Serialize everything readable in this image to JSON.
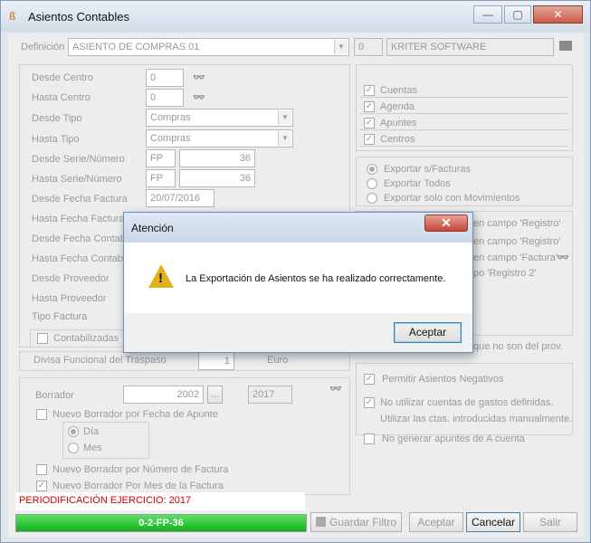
{
  "window": {
    "title": "Asientos Contables",
    "minimize": "—",
    "maximize": "▢",
    "close": "✕"
  },
  "definicion": {
    "label": "Definición",
    "value": "ASIENTO DE COMPRAS 01",
    "code": "0",
    "company": "KRITER SOFTWARE"
  },
  "filters": {
    "desde_centro": {
      "label": "Desde Centro",
      "value": "0"
    },
    "hasta_centro": {
      "label": "Hasta Centro",
      "value": "0"
    },
    "desde_tipo": {
      "label": "Desde Tipo",
      "value": "Compras"
    },
    "hasta_tipo": {
      "label": "Hasta Tipo",
      "value": "Compras"
    },
    "desde_serie": {
      "label": "Desde Serie/Número",
      "serie": "FP",
      "numero": "36"
    },
    "hasta_serie": {
      "label": "Hasta Serie/Número",
      "serie": "FP",
      "numero": "36"
    },
    "desde_fecha_factura": {
      "label": "Desde Fecha Factura",
      "value": "20/07/2016"
    },
    "hasta_fecha_factura": {
      "label": "Hasta Fecha Factura"
    },
    "desde_fecha_contable": {
      "label": "Desde Fecha Contable"
    },
    "hasta_fecha_contable": {
      "label": "Hasta Fecha Contable"
    },
    "desde_proveedor": {
      "label": "Desde Proveedor"
    },
    "hasta_proveedor": {
      "label": "Hasta Proveedor"
    },
    "tipo_factura": {
      "label": "Tipo Factura"
    },
    "contabilizadas": {
      "label": "Contabilizadas"
    }
  },
  "divisa": {
    "label": "Divisa Funcional del Traspaso",
    "value": "1",
    "currency": "Euro"
  },
  "borrador": {
    "label": "Borrador",
    "value": "2002",
    "ellipsis": "...",
    "year": "2017",
    "por_fecha": "Nuevo Borrador por Fecha de Apunte",
    "dia": "Día",
    "mes": "Mes",
    "por_numero": "Nuevo Borrador por Número de Factura",
    "por_mes": "Nuevo Borrador Por Mes de la Factura"
  },
  "right": {
    "checks": [
      "Cuentas",
      "Agenda",
      "Apuntes",
      "Centros"
    ],
    "export_options": [
      "Exportar s/Facturas",
      "Exportar Todos",
      "Exportar solo con Movimientos"
    ],
    "registro_lines": [
      "en campo 'Registro'",
      "en campo 'Registro'",
      "en campo 'Factura'",
      "po 'Registro 2'"
    ],
    "no_prov": "que no son del prov.",
    "permitir": "Permitir Asientos Negativos",
    "no_utilizar_1": "No utilizar cuentas de gastos definidas.",
    "no_utilizar_2": "Utilizar las ctas. introducidas manualmente.",
    "no_generar": "No generar apuntes de A cuenta"
  },
  "status": {
    "periodificacion": "PERIODIFICACIÓN EJERCICIO: 2017",
    "progress_text": "0-2-FP-36",
    "progress": 1.0
  },
  "buttons": {
    "guardar": "Guardar Filtro",
    "aceptar": "Aceptar",
    "cancelar": "Cancelar",
    "salir": "Salir"
  },
  "dialog": {
    "title": "Atención",
    "message": "La Exportación de Asientos se ha realizado correctamente.",
    "ok": "Aceptar",
    "close": "✕"
  },
  "colors": {
    "accent": "#3c7fb1",
    "progress": "#22c32a",
    "status_text": "#cc0000"
  }
}
